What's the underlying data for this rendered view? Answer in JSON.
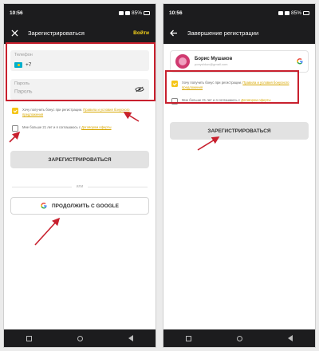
{
  "status_bar": {
    "time": "10:56",
    "battery": "85%"
  },
  "left": {
    "title": "Зарегистрироваться",
    "action": "Войти",
    "phone_label": "Телефон",
    "phone_value": "+7",
    "password_label": "Пароль",
    "password_placeholder": "Пароль",
    "bonus_text": "Хочу получить бонус при регистрации.",
    "bonus_link": "Правила и условия бонусного предложения",
    "age_text": "Мне больше 21 лет и я соглашаюсь с",
    "age_link": "Договором оферты",
    "register_button": "ЗАРЕГИСТРИРОВАТЬСЯ",
    "or_label": "или",
    "google_button": "ПРОДОЛЖИТЬ С GOOGLE"
  },
  "right": {
    "title": "Завершение регистрации",
    "account_name": "Борис Мушаков",
    "account_email": "ponyshkov@gmail.com",
    "bonus_text": "Хочу получить бонус при регистрации.",
    "bonus_link": "Правила и условия бонусного предложения",
    "age_text": "Мне больше 21 лет и я соглашаюсь с",
    "age_link": "Договором оферты",
    "register_button": "ЗАРЕГИСТРИРОВАТЬСЯ"
  },
  "colors": {
    "accent": "#f5c518",
    "highlight": "#c8202e",
    "bar": "#1c1c1e"
  }
}
